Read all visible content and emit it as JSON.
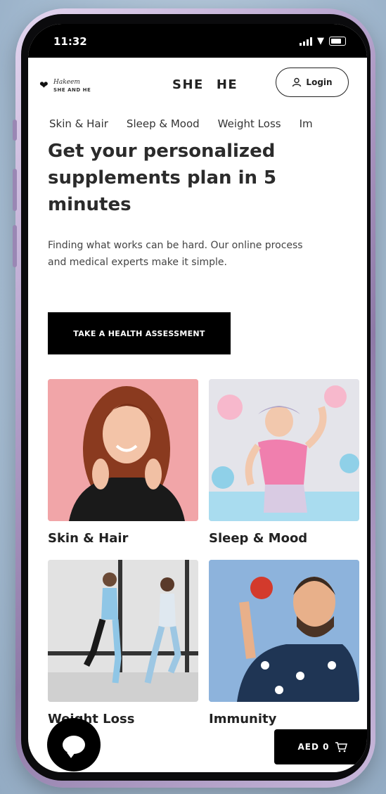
{
  "status_bar": {
    "time": "11:32"
  },
  "header": {
    "logo_text": "Hakeem",
    "logo_subtext": "SHE AND HE",
    "gender_nav": [
      "SHE",
      "HE"
    ],
    "login_label": "Login"
  },
  "category_tabs": [
    "Skin & Hair",
    "Sleep & Mood",
    "Weight Loss",
    "Im"
  ],
  "hero": {
    "title": "Get your personalized supplements plan in 5 minutes",
    "subtitle": "Finding what works can be hard. Our online process and medical experts make it simple.",
    "cta_label": "TAKE A HEALTH ASSESSMENT"
  },
  "categories": [
    {
      "label": "Skin & Hair"
    },
    {
      "label": "Sleep & Mood"
    },
    {
      "label": "Weight Loss"
    },
    {
      "label": "Immunity"
    }
  ],
  "cart": {
    "label": "AED 0"
  },
  "icons": {
    "user": "user-icon",
    "cart": "cart-icon",
    "chat": "chat-icon",
    "heart": "heart-logo-icon"
  },
  "colors": {
    "primary": "#000000",
    "background": "#ffffff",
    "text": "#2b2b2b"
  }
}
